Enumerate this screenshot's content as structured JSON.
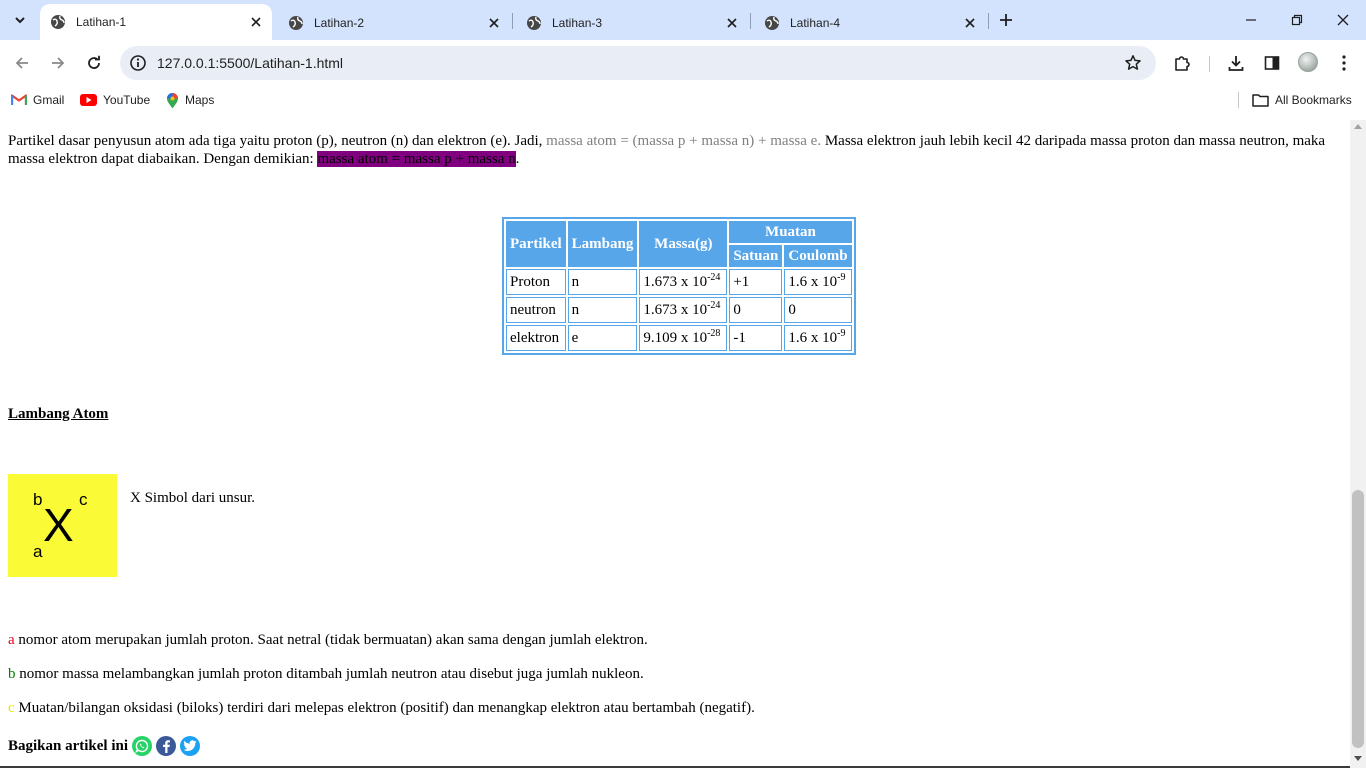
{
  "browser": {
    "tabs": [
      {
        "title": "Latihan-1",
        "active": true
      },
      {
        "title": "Latihan-2",
        "active": false
      },
      {
        "title": "Latihan-3",
        "active": false
      },
      {
        "title": "Latihan-4",
        "active": false
      }
    ],
    "url": "127.0.0.1:5500/Latihan-1.html",
    "bookmarks": [
      {
        "label": "Gmail",
        "icon": "gmail-icon"
      },
      {
        "label": "YouTube",
        "icon": "youtube-icon"
      },
      {
        "label": "Maps",
        "icon": "maps-icon"
      }
    ],
    "all_bookmarks": "All Bookmarks"
  },
  "page": {
    "intro": {
      "part1": "Partikel dasar penyusun atom ada tiga yaitu proton (p), neutron (n) dan elektron (e). Jadi, ",
      "gray_formula": "massa atom = (massa p + massa n) + massa e.",
      "part2": " Massa elektron jauh lebih kecil 42 daripada massa proton dan massa neutron, maka massa elektron dapat diabaikan. Dengan demikian: ",
      "highlight": "massa atom = massa p + massa n",
      "part3": "."
    },
    "table": {
      "headers": {
        "partikel": "Partikel",
        "lambang": "Lambang",
        "massa": "Massa(g)",
        "muatan": "Muatan",
        "satuan": "Satuan",
        "coulomb": "Coulomb"
      },
      "rows": [
        {
          "partikel": "Proton",
          "lambang": "n",
          "massa_base": "1.673 x 10",
          "massa_exp": "-24",
          "satuan": "+1",
          "coulomb_base": "1.6 x 10",
          "coulomb_exp": "-9"
        },
        {
          "partikel": "neutron",
          "lambang": "n",
          "massa_base": "1.673 x 10",
          "massa_exp": "-24",
          "satuan": "0",
          "coulomb_base": "0",
          "coulomb_exp": ""
        },
        {
          "partikel": "elektron",
          "lambang": "e",
          "massa_base": "9.109 x 10",
          "massa_exp": "-28",
          "satuan": "-1",
          "coulomb_base": "1.6 x 10",
          "coulomb_exp": "-9"
        }
      ]
    },
    "section_title": "Lambang Atom",
    "atom_symbol": {
      "a": "a",
      "b": "b",
      "c": "c",
      "x": "X"
    },
    "atom_desc": "X Simbol dari unsur.",
    "lines": [
      {
        "key": "a",
        "text": " nomor atom merupakan jumlah proton. Saat netral (tidak bermuatan) akan sama dengan jumlah elektron."
      },
      {
        "key": "b",
        "text": " nomor massa melambangkan jumlah proton ditambah jumlah neutron atau disebut juga jumlah nukleon."
      },
      {
        "key": "c",
        "text": " Muatan/bilangan oksidasi (biloks) terdiri dari melepas elektron (positif) dan menangkap elektron atau bertambah (negatif)."
      }
    ],
    "share_label": "Bagikan artikel ini",
    "share_icons": [
      "whatsapp-icon",
      "facebook-icon",
      "twitter-icon"
    ]
  },
  "colors": {
    "accent_blue": "#58a6ea",
    "highlight": "#800080",
    "atom_bg": "#fafa37"
  }
}
